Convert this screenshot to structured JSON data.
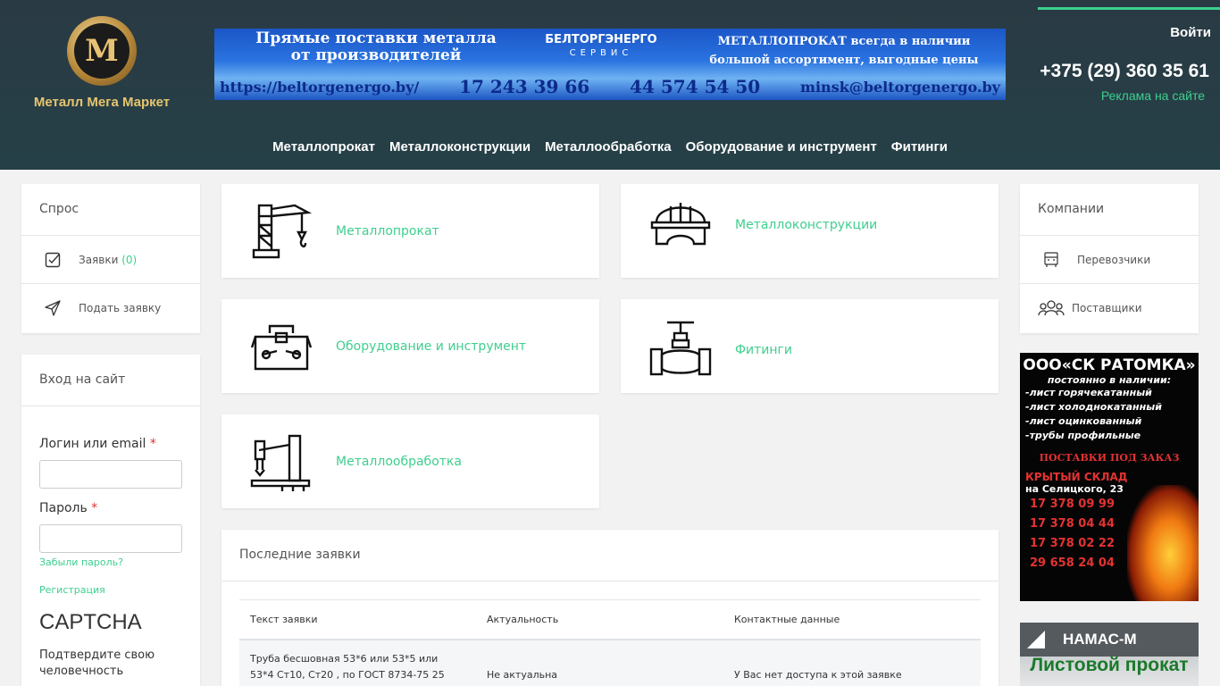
{
  "header": {
    "logo_text": "Металл Мега Маркет",
    "login": "Войти",
    "phone": "+375 (29) 360 35 61",
    "ads": "Реклама на сайте"
  },
  "banner": {
    "line1": "Прямые поставки металла от производителей",
    "brand": "БЕЛТОРГЭНЕРГО",
    "brand_sub": "СЕРВИС",
    "line3a": "МЕТАЛЛОПРОКАТ всегда в наличии",
    "line3b": "большой ассортимент, выгодные цены",
    "url": "https://beltorgenergo.by/",
    "phone1": "17 243 39 66",
    "phone2": "44 574 54 50",
    "email": "minsk@beltorgenergo.by"
  },
  "nav": [
    "Металлопрокат",
    "Металлоконструкции",
    "Металлообработка",
    "Оборудование и инструмент",
    "Фитинги"
  ],
  "demand": {
    "title": "Спрос",
    "requests_label": "Заявки",
    "requests_count": "(0)",
    "submit_label": "Подать заявку"
  },
  "login_box": {
    "title": "Вход на сайт",
    "login_label": "Логин или email",
    "password_label": "Пароль",
    "required_mark": "*",
    "forgot": "Забыли пароль?",
    "register": "Регистрация",
    "captcha": "CAPTCHA",
    "confirm": "Подтвердите свою человечность"
  },
  "categories": {
    "metalloprokat": "Металлопрокат",
    "metallokonstr": "Металлоконструкции",
    "equipment": "Оборудование и инструмент",
    "fittings": "Фитинги",
    "metalloobr": "Металлообработка"
  },
  "latest": {
    "title": "Последние заявки",
    "headers": [
      "Текст заявки",
      "Актуальность",
      "Контактные данные"
    ],
    "row": {
      "text": "Труба бесшовная 53*6 или 53*5 или 53*4 Ст10, Ст20 , по ГОСТ 8734-75 25",
      "status": "Не актуальна",
      "contact": "У Вас нет доступа к этой заявке"
    }
  },
  "companies": {
    "title": "Компании",
    "carriers": "Перевозчики",
    "suppliers": "Поставщики"
  },
  "ad1": {
    "title": "ООО«СК РАТОМКА»",
    "subtitle": "постоянно в наличии:",
    "items": [
      "-лист горячекатанный",
      "-лист холоднокатанный",
      "-лист оцинкованный",
      "-трубы профильные"
    ],
    "order": "ПОСТАВКИ ПОД ЗАКАЗ",
    "warehouse": "КРЫТЫЙ СКЛАД",
    "address": "на Селицкого, 23",
    "phones": [
      "17 378 09 99",
      "17 378 04 44",
      "17 378 02 22",
      "29 658 24 04"
    ]
  },
  "ad2": {
    "brand": "НАМАС-М",
    "text": "Листовой прокат"
  }
}
